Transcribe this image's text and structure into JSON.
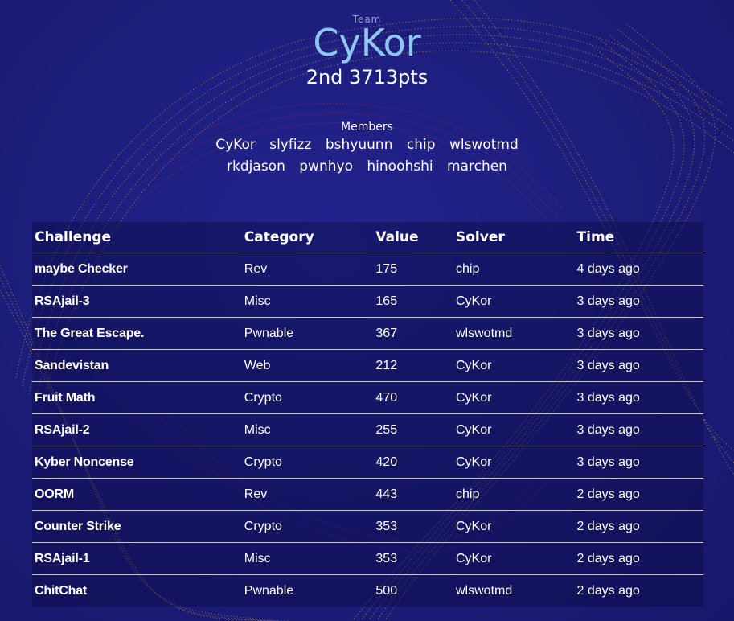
{
  "team": {
    "label": "Team",
    "name": "CyKor",
    "rank_points": "2nd 3713pts"
  },
  "members": {
    "label": "Members",
    "row1": [
      "CyKor",
      "slyfizz",
      "bshyuunn",
      "chip",
      "wlswotmd"
    ],
    "row2": [
      "rkdjason",
      "pwnhyo",
      "hinoohshi",
      "marchen"
    ]
  },
  "table": {
    "headers": {
      "challenge": "Challenge",
      "category": "Category",
      "value": "Value",
      "solver": "Solver",
      "time": "Time"
    },
    "rows": [
      {
        "challenge": "maybe Checker",
        "category": "Rev",
        "value": "175",
        "solver": "chip",
        "time": "4 days ago"
      },
      {
        "challenge": "RSAjail-3",
        "category": "Misc",
        "value": "165",
        "solver": "CyKor",
        "time": "3 days ago"
      },
      {
        "challenge": "The Great Escape.",
        "category": "Pwnable",
        "value": "367",
        "solver": "wlswotmd",
        "time": "3 days ago"
      },
      {
        "challenge": "Sandevistan",
        "category": "Web",
        "value": "212",
        "solver": "CyKor",
        "time": "3 days ago"
      },
      {
        "challenge": "Fruit Math",
        "category": "Crypto",
        "value": "470",
        "solver": "CyKor",
        "time": "3 days ago"
      },
      {
        "challenge": "RSAjail-2",
        "category": "Misc",
        "value": "255",
        "solver": "CyKor",
        "time": "3 days ago"
      },
      {
        "challenge": "Kyber Noncense",
        "category": "Crypto",
        "value": "420",
        "solver": "CyKor",
        "time": "3 days ago"
      },
      {
        "challenge": "OORM",
        "category": "Rev",
        "value": "443",
        "solver": "chip",
        "time": "2 days ago"
      },
      {
        "challenge": "Counter Strike",
        "category": "Crypto",
        "value": "353",
        "solver": "CyKor",
        "time": "2 days ago"
      },
      {
        "challenge": "RSAjail-1",
        "category": "Misc",
        "value": "353",
        "solver": "CyKor",
        "time": "2 days ago"
      },
      {
        "challenge": "ChitChat",
        "category": "Pwnable",
        "value": "500",
        "solver": "wlswotmd",
        "time": "2 days ago"
      }
    ]
  },
  "colors": {
    "background": "#1e1e7e",
    "team_name": "#8ec5f2",
    "wave_gold": "#c8a43a",
    "wave_red": "#a8324a"
  }
}
